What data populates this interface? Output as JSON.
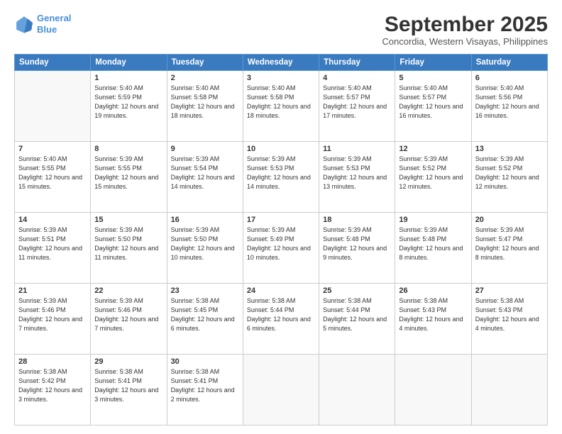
{
  "header": {
    "logo_line1": "General",
    "logo_line2": "Blue",
    "month": "September 2025",
    "location": "Concordia, Western Visayas, Philippines"
  },
  "days_of_week": [
    "Sunday",
    "Monday",
    "Tuesday",
    "Wednesday",
    "Thursday",
    "Friday",
    "Saturday"
  ],
  "weeks": [
    [
      {
        "day": "",
        "empty": true
      },
      {
        "day": "1",
        "sunrise": "5:40 AM",
        "sunset": "5:59 PM",
        "daylight": "12 hours and 19 minutes."
      },
      {
        "day": "2",
        "sunrise": "5:40 AM",
        "sunset": "5:58 PM",
        "daylight": "12 hours and 18 minutes."
      },
      {
        "day": "3",
        "sunrise": "5:40 AM",
        "sunset": "5:58 PM",
        "daylight": "12 hours and 18 minutes."
      },
      {
        "day": "4",
        "sunrise": "5:40 AM",
        "sunset": "5:57 PM",
        "daylight": "12 hours and 17 minutes."
      },
      {
        "day": "5",
        "sunrise": "5:40 AM",
        "sunset": "5:57 PM",
        "daylight": "12 hours and 16 minutes."
      },
      {
        "day": "6",
        "sunrise": "5:40 AM",
        "sunset": "5:56 PM",
        "daylight": "12 hours and 16 minutes."
      }
    ],
    [
      {
        "day": "7",
        "sunrise": "5:40 AM",
        "sunset": "5:55 PM",
        "daylight": "12 hours and 15 minutes."
      },
      {
        "day": "8",
        "sunrise": "5:39 AM",
        "sunset": "5:55 PM",
        "daylight": "12 hours and 15 minutes."
      },
      {
        "day": "9",
        "sunrise": "5:39 AM",
        "sunset": "5:54 PM",
        "daylight": "12 hours and 14 minutes."
      },
      {
        "day": "10",
        "sunrise": "5:39 AM",
        "sunset": "5:53 PM",
        "daylight": "12 hours and 14 minutes."
      },
      {
        "day": "11",
        "sunrise": "5:39 AM",
        "sunset": "5:53 PM",
        "daylight": "12 hours and 13 minutes."
      },
      {
        "day": "12",
        "sunrise": "5:39 AM",
        "sunset": "5:52 PM",
        "daylight": "12 hours and 12 minutes."
      },
      {
        "day": "13",
        "sunrise": "5:39 AM",
        "sunset": "5:52 PM",
        "daylight": "12 hours and 12 minutes."
      }
    ],
    [
      {
        "day": "14",
        "sunrise": "5:39 AM",
        "sunset": "5:51 PM",
        "daylight": "12 hours and 11 minutes."
      },
      {
        "day": "15",
        "sunrise": "5:39 AM",
        "sunset": "5:50 PM",
        "daylight": "12 hours and 11 minutes."
      },
      {
        "day": "16",
        "sunrise": "5:39 AM",
        "sunset": "5:50 PM",
        "daylight": "12 hours and 10 minutes."
      },
      {
        "day": "17",
        "sunrise": "5:39 AM",
        "sunset": "5:49 PM",
        "daylight": "12 hours and 10 minutes."
      },
      {
        "day": "18",
        "sunrise": "5:39 AM",
        "sunset": "5:48 PM",
        "daylight": "12 hours and 9 minutes."
      },
      {
        "day": "19",
        "sunrise": "5:39 AM",
        "sunset": "5:48 PM",
        "daylight": "12 hours and 8 minutes."
      },
      {
        "day": "20",
        "sunrise": "5:39 AM",
        "sunset": "5:47 PM",
        "daylight": "12 hours and 8 minutes."
      }
    ],
    [
      {
        "day": "21",
        "sunrise": "5:39 AM",
        "sunset": "5:46 PM",
        "daylight": "12 hours and 7 minutes."
      },
      {
        "day": "22",
        "sunrise": "5:39 AM",
        "sunset": "5:46 PM",
        "daylight": "12 hours and 7 minutes."
      },
      {
        "day": "23",
        "sunrise": "5:38 AM",
        "sunset": "5:45 PM",
        "daylight": "12 hours and 6 minutes."
      },
      {
        "day": "24",
        "sunrise": "5:38 AM",
        "sunset": "5:44 PM",
        "daylight": "12 hours and 6 minutes."
      },
      {
        "day": "25",
        "sunrise": "5:38 AM",
        "sunset": "5:44 PM",
        "daylight": "12 hours and 5 minutes."
      },
      {
        "day": "26",
        "sunrise": "5:38 AM",
        "sunset": "5:43 PM",
        "daylight": "12 hours and 4 minutes."
      },
      {
        "day": "27",
        "sunrise": "5:38 AM",
        "sunset": "5:43 PM",
        "daylight": "12 hours and 4 minutes."
      }
    ],
    [
      {
        "day": "28",
        "sunrise": "5:38 AM",
        "sunset": "5:42 PM",
        "daylight": "12 hours and 3 minutes."
      },
      {
        "day": "29",
        "sunrise": "5:38 AM",
        "sunset": "5:41 PM",
        "daylight": "12 hours and 3 minutes."
      },
      {
        "day": "30",
        "sunrise": "5:38 AM",
        "sunset": "5:41 PM",
        "daylight": "12 hours and 2 minutes."
      },
      {
        "day": "",
        "empty": true
      },
      {
        "day": "",
        "empty": true
      },
      {
        "day": "",
        "empty": true
      },
      {
        "day": "",
        "empty": true
      }
    ]
  ]
}
